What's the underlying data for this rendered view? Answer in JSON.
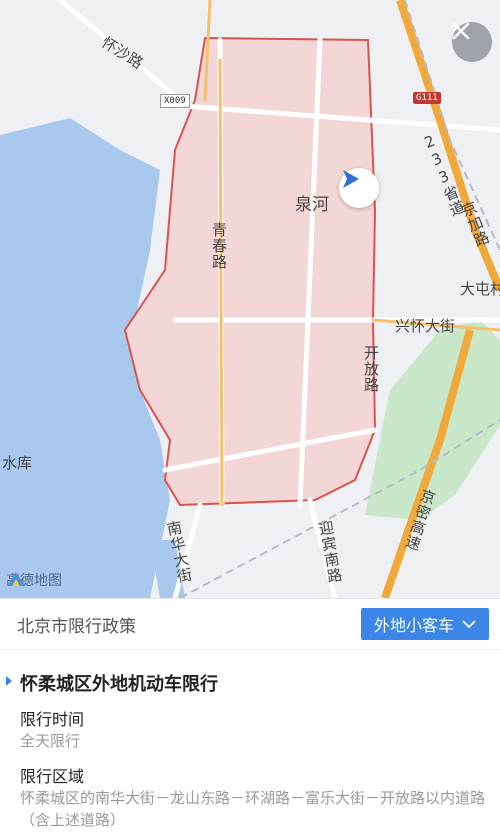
{
  "map": {
    "labels": {
      "huaisha_road": "怀沙路",
      "quanhe": "泉河",
      "qingchun_road": "青春路",
      "kaifang_road": "开放路",
      "xinghuai_street": "兴怀大街",
      "datun": "大屯村",
      "shuiku": "水库",
      "nanhua_street": "南华大街",
      "yingbin_road": "迎宾南路",
      "jingmi_expressway": "京密高速",
      "road_233": "233省道",
      "jingjia_road": "京加路"
    },
    "badges": {
      "x009": "X009",
      "g111": "G111"
    },
    "logo_text": "高德地图",
    "icons": {
      "close": "close-icon",
      "navigation": "navigation-arrow-icon",
      "logo": "amap-logo-icon"
    },
    "colors": {
      "restricted_fill": "#f3d6d6",
      "restricted_border": "#d9534f",
      "water": "#a9c8ee",
      "park": "#c9e8c9"
    }
  },
  "policy": {
    "title": "北京市限行政策",
    "vehicle_button": "外地小客车"
  },
  "detail": {
    "section_title": "怀柔城区外地机动车限行",
    "time_label": "限行时间",
    "time_value": "全天限行",
    "area_label": "限行区域",
    "area_value": "怀柔城区的南华大街－龙山东路－环湖路－富乐大街－开放路以内道路（含上述道路）"
  },
  "accent_color": "#3b86e6"
}
